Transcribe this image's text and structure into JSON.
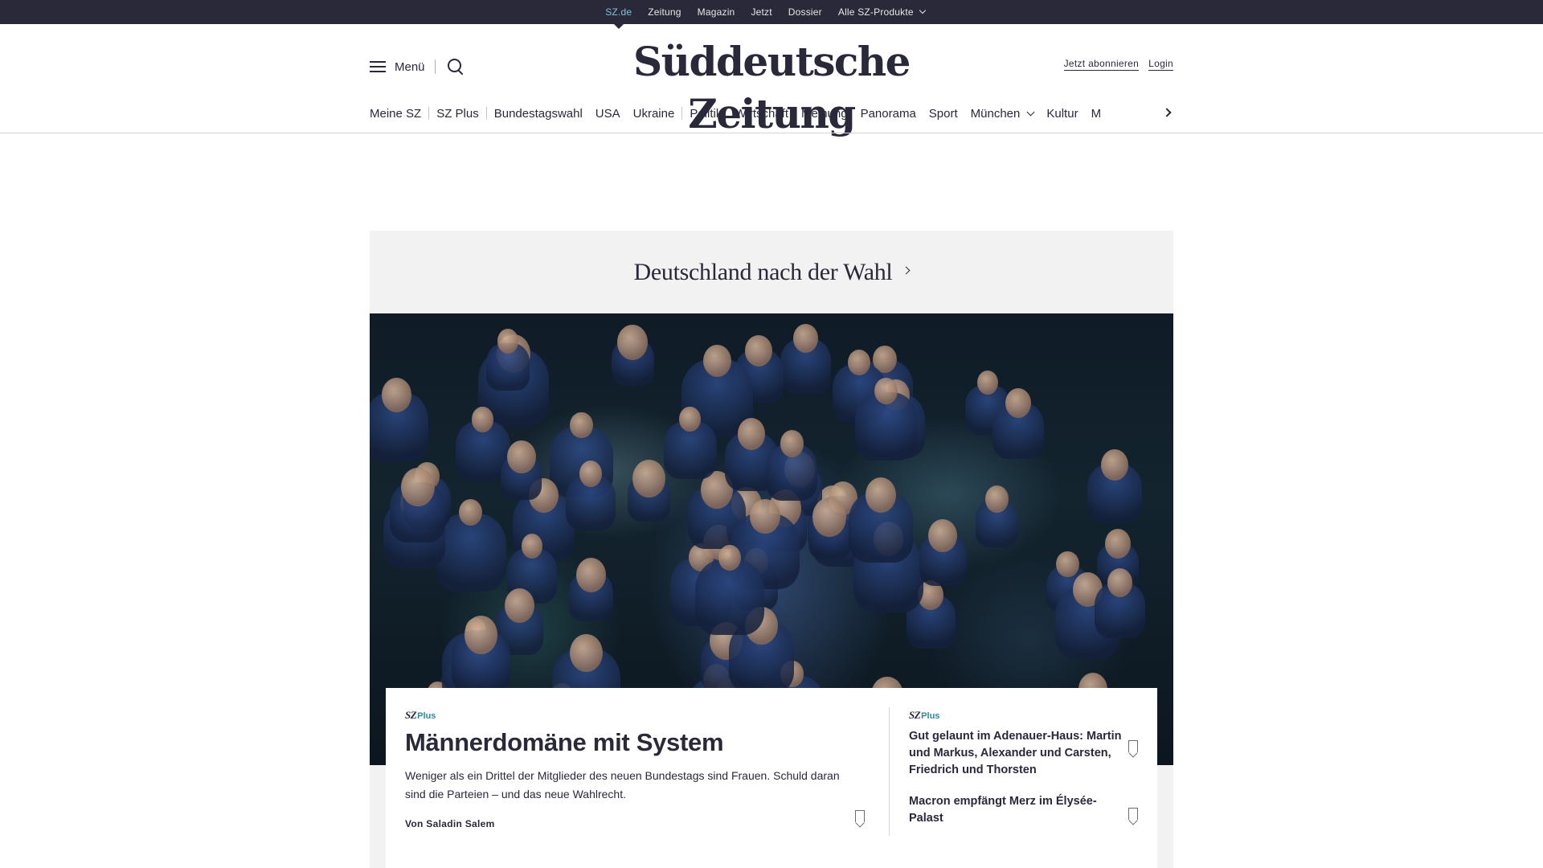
{
  "topbar": {
    "links": [
      "SZ.de",
      "Zeitung",
      "Magazin",
      "Jetzt",
      "Dossier"
    ],
    "products_label": "Alle SZ-Produkte",
    "active": "SZ.de"
  },
  "header": {
    "menu_label": "Menü",
    "logo": "Süddeutsche Zeitung",
    "subscribe_label": "Jetzt abonnieren",
    "login_label": "Login"
  },
  "nav": {
    "items": [
      "Meine SZ",
      "SZ Plus",
      "Bundestagswahl",
      "USA",
      "Ukraine",
      "Politik",
      "Wirtschaft",
      "Meinung",
      "Panorama",
      "Sport",
      "München",
      "Kultur",
      "M"
    ]
  },
  "dossier": {
    "title": "Deutschland nach der Wahl"
  },
  "badge": {
    "sz": "SZ",
    "plus": "Plus"
  },
  "main_article": {
    "title": "Männerdomäne mit System",
    "teaser": "Weniger als ein Drittel der Mitglieder des neuen Bundestags sind Frauen. Schuld daran sind die Parteien – und das neue Wahlrecht.",
    "author": "Von Saladin Salem"
  },
  "side_articles": [
    {
      "title": "Gut gelaunt im Adenauer-Haus: Martin und Markus, Alexander und Carsten, Friedrich und Thorsten",
      "plus": true
    },
    {
      "title": "Macron empfängt Merz im Élysée-Palast",
      "plus": false
    }
  ],
  "colors": {
    "brand_dark": "#29293a",
    "plus_accent": "#2a8c99",
    "dossier_bg": "#f2f2f2"
  },
  "icons": [
    "menu-icon",
    "search-icon",
    "chevron-down-icon",
    "chevron-right-icon",
    "bookmark-icon"
  ]
}
